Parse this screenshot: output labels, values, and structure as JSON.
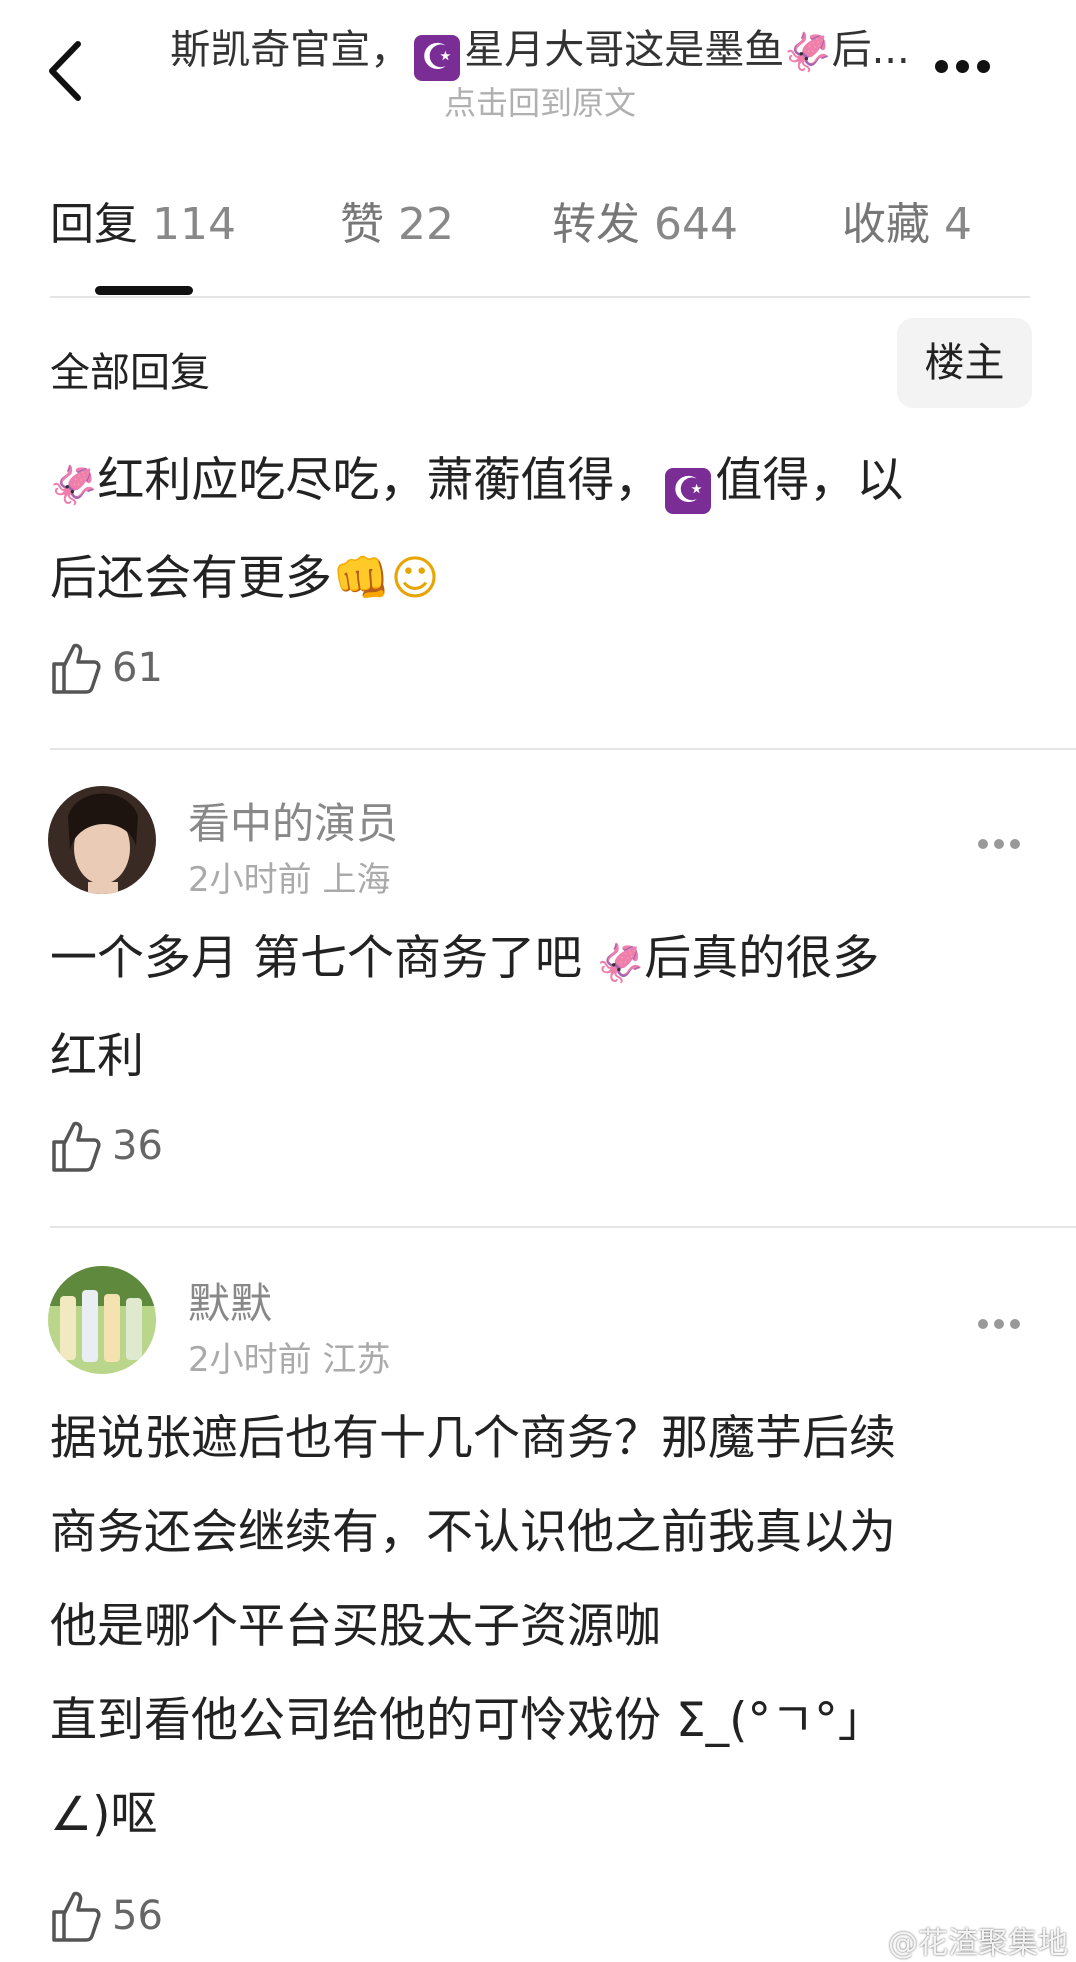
{
  "header": {
    "title_prefix": "斯凯奇官宣，",
    "title_mid": "星月大哥这是墨鱼",
    "title_suffix": "后...",
    "subtitle": "点击回到原文",
    "moon_glyph": "☪",
    "squid_glyph": "🦑"
  },
  "tabs": [
    {
      "label": "回复",
      "count": "114",
      "active": true
    },
    {
      "label": "赞",
      "count": "22",
      "active": false
    },
    {
      "label": "转发",
      "count": "644",
      "active": false
    },
    {
      "label": "收藏",
      "count": "4",
      "active": false
    }
  ],
  "section": {
    "title": "全部回复",
    "owner_button": "楼主"
  },
  "op_comment": {
    "line1_a": "红利应吃尽吃，萧蘅值得，",
    "line1_b": "值得，以",
    "line2": "后还会有更多",
    "fist": "👊",
    "smile": "☺",
    "likes": "61"
  },
  "comments": [
    {
      "username": "看中的演员",
      "meta": "2小时前 上海",
      "text_line1_a": "一个多月 第七个商务了吧 ",
      "text_line1_b": "后真的很多",
      "text_line2": "红利",
      "likes": "36"
    },
    {
      "username": "默默",
      "meta": "2小时前 江苏",
      "text_lines": [
        "据说张遮后也有十几个商务？那魔芋后续",
        "商务还会继续有，不认识他之前我真以为",
        "他是哪个平台买股太子资源咖",
        "直到看他公司给他的可怜戏份 Σ_(°ㄱ°」",
        "∠)呕"
      ],
      "likes": "56"
    }
  ],
  "watermark": "@花渣聚集地",
  "colors": {
    "accent": "#111111",
    "muted": "#888888",
    "moon_bg": "#7b2d96",
    "squid": "#e06aa0"
  }
}
